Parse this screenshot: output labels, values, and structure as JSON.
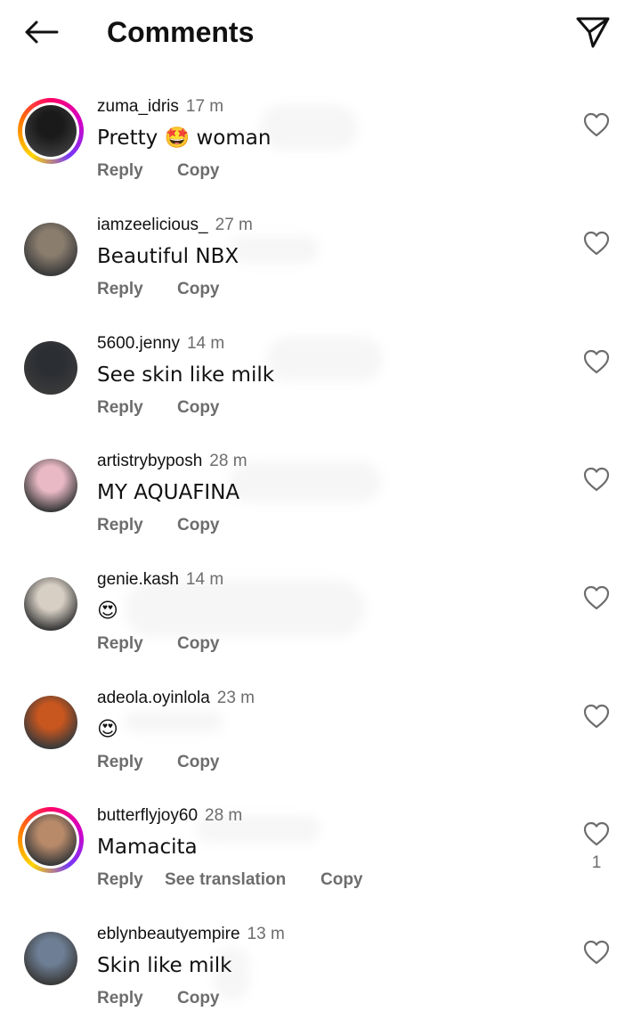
{
  "header": {
    "title": "Comments",
    "back_icon": "arrow-left-icon",
    "send_icon": "paper-plane-icon"
  },
  "colors": {
    "text": "#111111",
    "secondary": "#6d6d6d",
    "story_ring": "#d300c5"
  },
  "comments": [
    {
      "username": "zuma_idris",
      "time": "17 m",
      "text": "Pretty 🤩 woman",
      "reply": "Reply",
      "copy": "Copy",
      "story": true,
      "avatar_color": "#1a1a1a"
    },
    {
      "username": "iamzeelicious_",
      "time": "27 m",
      "text": "Beautiful NBX",
      "reply": "Reply",
      "copy": "Copy",
      "story": false,
      "avatar_color": "#8a7d6e"
    },
    {
      "username": "5600.jenny",
      "time": "14 m",
      "text": "See skin like milk",
      "reply": "Reply",
      "copy": "Copy",
      "story": false,
      "avatar_color": "#2b2e33"
    },
    {
      "username": "artistrybyposh",
      "time": "28 m",
      "text": "MY AQUAFINA",
      "reply": "Reply",
      "copy": "Copy",
      "story": false,
      "avatar_color": "#e9b9c6"
    },
    {
      "username": "genie.kash",
      "time": "14 m",
      "text": "😍",
      "reply": "Reply",
      "copy": "Copy",
      "story": false,
      "avatar_color": "#d7cfc4"
    },
    {
      "username": "adeola.oyinlola",
      "time": "23 m",
      "text": "😍",
      "reply": "Reply",
      "copy": "Copy",
      "story": false,
      "avatar_color": "#c8561f"
    },
    {
      "username": "butterflyjoy60",
      "time": "28 m",
      "text": "Mamacita",
      "reply": "Reply",
      "translate": "See translation",
      "copy": "Copy",
      "story": true,
      "likes": "1",
      "avatar_color": "#b88a6a"
    },
    {
      "username": "eblynbeautyempire",
      "time": "13 m",
      "text": "Skin like milk",
      "reply": "Reply",
      "copy": "Copy",
      "story": false,
      "avatar_color": "#6e7f95"
    }
  ]
}
